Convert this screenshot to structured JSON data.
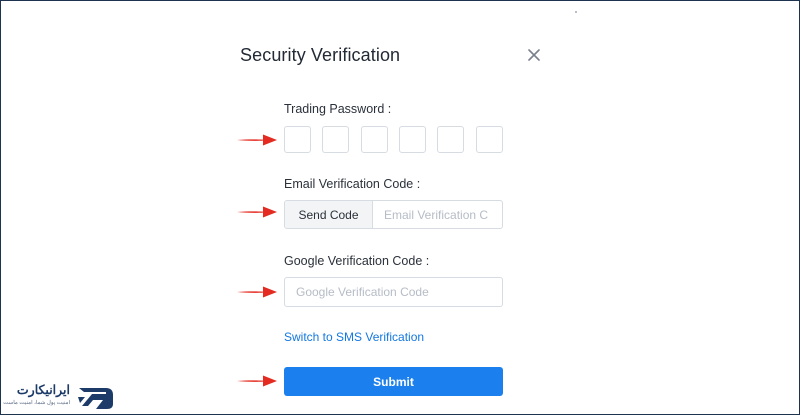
{
  "dialog": {
    "title": "Security Verification",
    "close_icon": "close-icon"
  },
  "trading_password": {
    "label": "Trading Password :",
    "digits": 6
  },
  "email_verification": {
    "label": "Email Verification Code :",
    "send_button": "Send Code",
    "placeholder": "Email Verification C"
  },
  "google_verification": {
    "label": "Google Verification Code :",
    "placeholder": "Google Verification Code"
  },
  "sms_link": "Switch to SMS Verification",
  "submit_button": "Submit",
  "annotations": {
    "arrow_icon": "red-arrow-icon",
    "arrow_color": "#e42b21"
  },
  "watermark": {
    "name": "ایرانیکارت",
    "tagline": "امنیت پول شما، امنیت ماست"
  },
  "colors": {
    "accent": "#1b80ed",
    "link": "#1478e0",
    "border": "#d7dbe2"
  }
}
